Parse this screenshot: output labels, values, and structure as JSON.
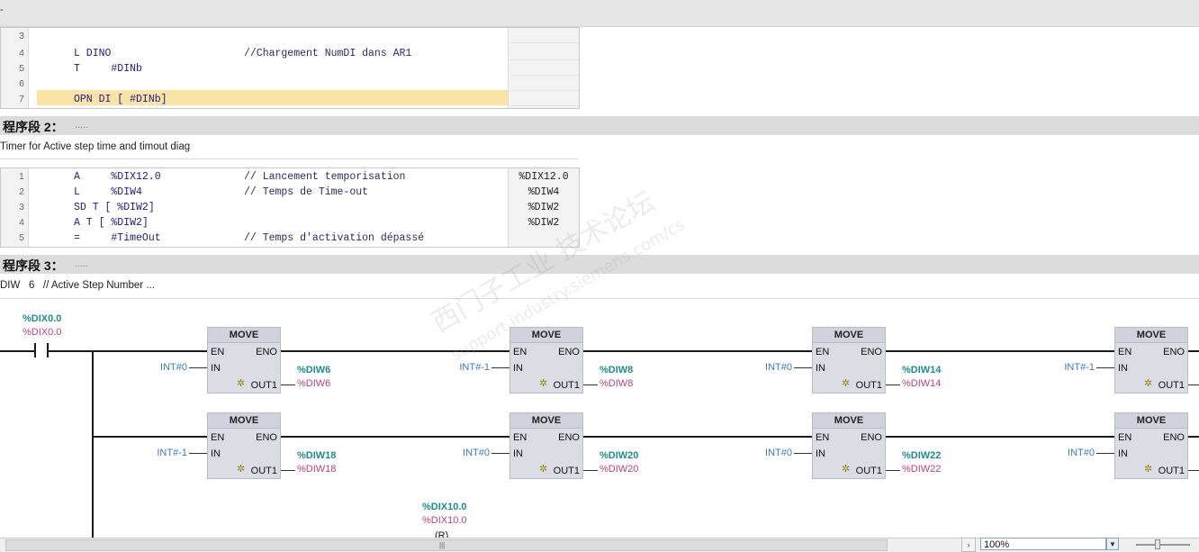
{
  "top": {
    "mark": "-"
  },
  "stl1": {
    "rows": [
      {
        "n": "3",
        "code": "",
        "comment": "",
        "op": ""
      },
      {
        "n": "4",
        "code": "L DINO",
        "comment": "//Chargement NumDI dans AR1",
        "op": ""
      },
      {
        "n": "5",
        "code": "T     #DINb",
        "comment": "",
        "op": ""
      },
      {
        "n": "6",
        "code": "",
        "comment": "",
        "op": ""
      },
      {
        "n": "7",
        "code": "OPN DI [ #DINb]",
        "comment": "",
        "op": ""
      }
    ]
  },
  "network2": {
    "title": "程序段 2：",
    "dots": ".....",
    "comment": "Timer for Active step time and timout diag",
    "rows": [
      {
        "n": "1",
        "code": "A     %DIX12.0",
        "comment": "// Lancement temporisation",
        "op": "%DIX12.0"
      },
      {
        "n": "2",
        "code": "L     %DIW4",
        "comment": "// Temps de Time-out",
        "op": "%DIW4"
      },
      {
        "n": "3",
        "code": "SD T [ %DIW2]",
        "comment": "",
        "op": "%DIW2"
      },
      {
        "n": "4",
        "code": "A T [ %DIW2]",
        "comment": "",
        "op": "%DIW2"
      },
      {
        "n": "5",
        "code": "=     #TimeOut",
        "comment": "// Temps d'activation dépassé",
        "op": ""
      }
    ]
  },
  "network3": {
    "title": "程序段 3：",
    "dots": ".....",
    "comment": "DIW   6   // Active Step Number ...",
    "contact": {
      "top": "%DIX0.0",
      "bottom": "%DIX0.0"
    },
    "coil_label": {
      "top": "%DIX10.0",
      "bottom": "%DIX10.0"
    },
    "coil_partial": "(R)",
    "boxes": [
      {
        "title": "MOVE",
        "en": "EN",
        "eno": "ENO",
        "in_pin": "IN",
        "out_pin": "OUT1",
        "in_val": "INT#0",
        "out_top": "%DIW6",
        "out_bot": "%DIW6"
      },
      {
        "title": "MOVE",
        "en": "EN",
        "eno": "ENO",
        "in_pin": "IN",
        "out_pin": "OUT1",
        "in_val": "INT#-1",
        "out_top": "%DIW8",
        "out_bot": "%DIW8"
      },
      {
        "title": "MOVE",
        "en": "EN",
        "eno": "ENO",
        "in_pin": "IN",
        "out_pin": "OUT1",
        "in_val": "INT#0",
        "out_top": "%DIW14",
        "out_bot": "%DIW14"
      },
      {
        "title": "MOVE",
        "en": "EN",
        "eno": "ENO",
        "in_pin": "IN",
        "out_pin": "OUT1",
        "in_val": "INT#-1",
        "out_top": "",
        "out_bot": ""
      },
      {
        "title": "MOVE",
        "en": "EN",
        "eno": "ENO",
        "in_pin": "IN",
        "out_pin": "OUT1",
        "in_val": "INT#-1",
        "out_top": "%DIW18",
        "out_bot": "%DIW18"
      },
      {
        "title": "MOVE",
        "en": "EN",
        "eno": "ENO",
        "in_pin": "IN",
        "out_pin": "OUT1",
        "in_val": "INT#0",
        "out_top": "%DIW20",
        "out_bot": "%DIW20"
      },
      {
        "title": "MOVE",
        "en": "EN",
        "eno": "ENO",
        "in_pin": "IN",
        "out_pin": "OUT1",
        "in_val": "INT#0",
        "out_top": "%DIW22",
        "out_bot": "%DIW22"
      },
      {
        "title": "MOVE",
        "en": "EN",
        "eno": "ENO",
        "in_pin": "IN",
        "out_pin": "OUT1",
        "in_val": "INT#0",
        "out_top": "",
        "out_bot": ""
      }
    ]
  },
  "watermark": {
    "cn": "西门子工业 技术论坛",
    "url": "support.industry.siemens.com/cs"
  },
  "status": {
    "zoom": "100%",
    "grip": "|||",
    "arrow": "›",
    "dropdown": "▼"
  }
}
